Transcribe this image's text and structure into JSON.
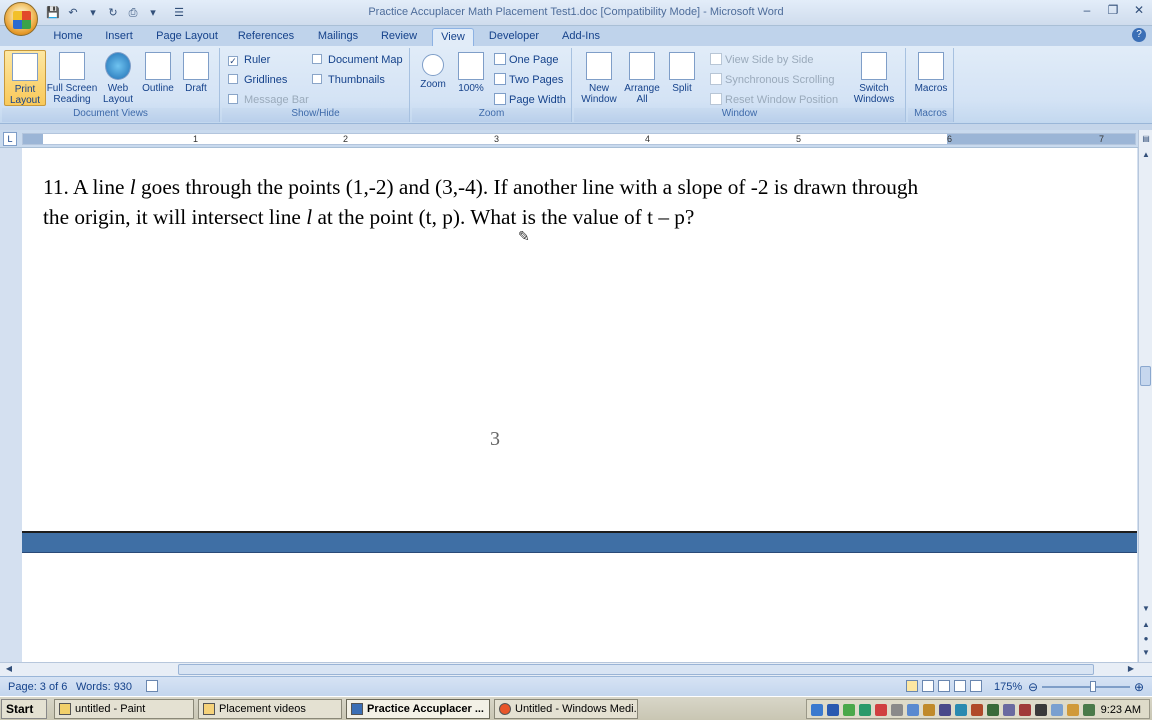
{
  "window": {
    "title": "Practice Accuplacer Math Placement Test1.doc [Compatibility Mode] - Microsoft Word"
  },
  "tabs": [
    {
      "label": "Home",
      "active": false
    },
    {
      "label": "Insert",
      "active": false
    },
    {
      "label": "Page Layout",
      "active": false
    },
    {
      "label": "References",
      "active": false
    },
    {
      "label": "Mailings",
      "active": false
    },
    {
      "label": "Review",
      "active": false
    },
    {
      "label": "View",
      "active": true
    },
    {
      "label": "Developer",
      "active": false
    },
    {
      "label": "Add-Ins",
      "active": false
    }
  ],
  "ribbon": {
    "document_views": {
      "label": "Document Views",
      "print_layout": "Print Layout",
      "full_screen_reading": "Full Screen Reading",
      "web_layout": "Web Layout",
      "outline": "Outline",
      "draft": "Draft"
    },
    "show_hide": {
      "label": "Show/Hide",
      "ruler": "Ruler",
      "ruler_checked": true,
      "gridlines": "Gridlines",
      "message_bar": "Message Bar",
      "document_map": "Document Map",
      "thumbnails": "Thumbnails"
    },
    "zoom": {
      "label": "Zoom",
      "zoom": "Zoom",
      "hundred": "100%",
      "one_page": "One Page",
      "two_pages": "Two Pages",
      "page_width": "Page Width"
    },
    "window": {
      "label": "Window",
      "new_window": "New Window",
      "arrange_all": "Arrange All",
      "split": "Split",
      "view_side_by_side": "View Side by Side",
      "synchronous_scrolling": "Synchronous Scrolling",
      "reset_window_position": "Reset Window Position",
      "switch_windows": "Switch Windows"
    },
    "macros": {
      "label": "Macros",
      "macros": "Macros"
    }
  },
  "ruler": {
    "numbers": [
      "1",
      "2",
      "3",
      "4",
      "5",
      "6",
      "7"
    ],
    "corner": "L"
  },
  "document": {
    "question_part1": "11. A line ",
    "italic_l": "l",
    "question_part2": " goes through the points (1,-2) and (3,-4).  If another line with a slope of -2 is drawn through the origin, it will intersect line ",
    "question_part3": " at the point (t, p). What is the value of t – p?",
    "page_number": "3"
  },
  "statusbar": {
    "page": "Page: 3 of 6",
    "words": "Words: 930",
    "zoom_level": "175%"
  },
  "taskbar": {
    "start": "Start",
    "tasks": [
      {
        "label": "untitled - Paint",
        "active": false
      },
      {
        "label": "Placement videos",
        "active": false
      },
      {
        "label": "Practice Accuplacer ...",
        "active": true
      },
      {
        "label": "Untitled - Windows Medi...",
        "active": false
      }
    ],
    "clock": "9:23 AM"
  },
  "colors": {
    "accent": "#15428b",
    "ribbon_bg": "#d4e3f5",
    "page_break": "#3f6fa5"
  }
}
